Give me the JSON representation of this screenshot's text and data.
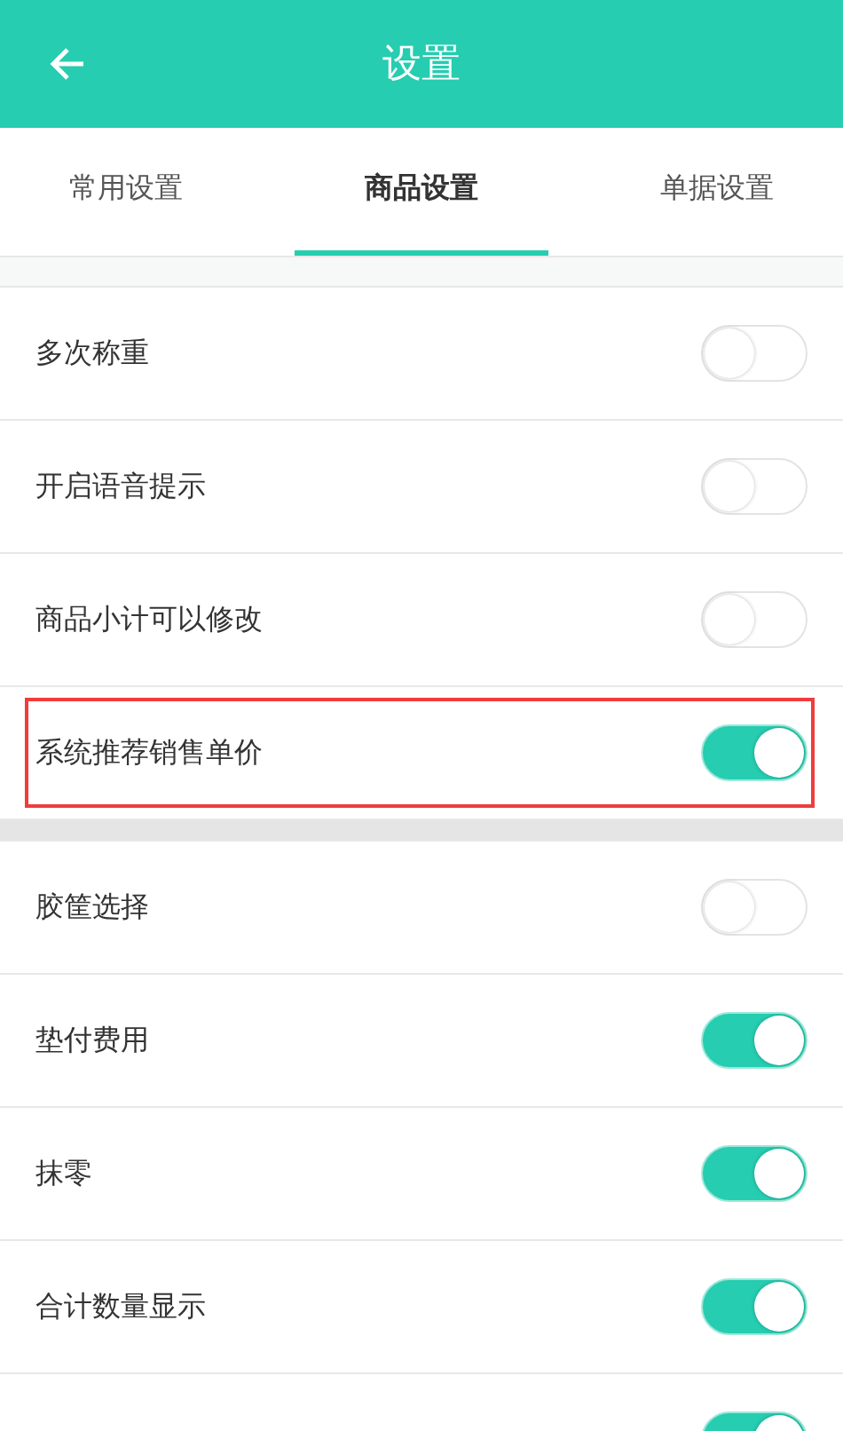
{
  "header": {
    "title": "设置"
  },
  "tabs": [
    {
      "label": "常用设置",
      "selected": false
    },
    {
      "label": "商品设置",
      "selected": true
    },
    {
      "label": "单据设置",
      "selected": false
    }
  ],
  "sections": [
    {
      "rows": [
        {
          "label": "多次称重",
          "on": false,
          "highlighted": false
        },
        {
          "label": "开启语音提示",
          "on": false,
          "highlighted": false
        },
        {
          "label": "商品小计可以修改",
          "on": false,
          "highlighted": false
        },
        {
          "label": "系统推荐销售单价",
          "on": true,
          "highlighted": true
        }
      ]
    },
    {
      "rows": [
        {
          "label": "胶筐选择",
          "on": false,
          "highlighted": false
        },
        {
          "label": "垫付费用",
          "on": true,
          "highlighted": false
        },
        {
          "label": "抹零",
          "on": true,
          "highlighted": false
        },
        {
          "label": "合计数量显示",
          "on": true,
          "highlighted": false
        },
        {
          "on": true,
          "highlighted": false
        }
      ]
    }
  ]
}
